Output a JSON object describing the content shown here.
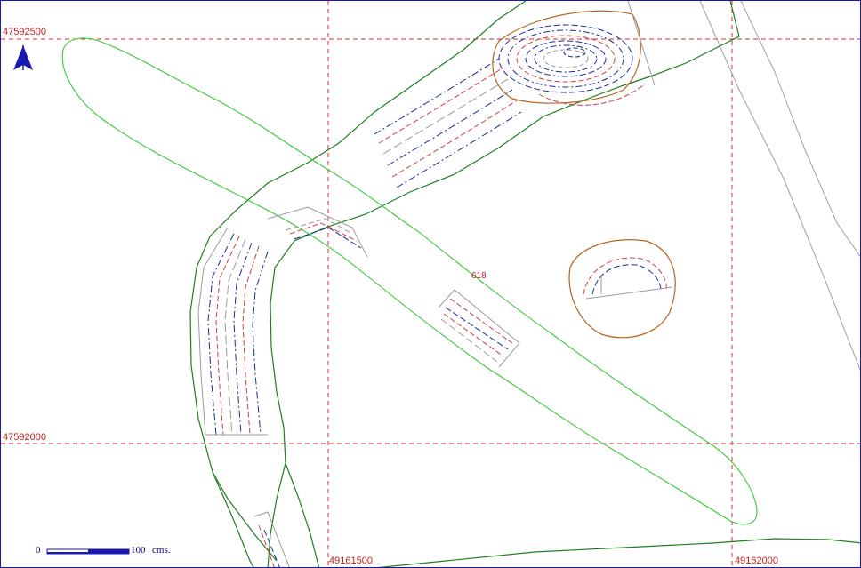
{
  "map": {
    "grid": {
      "northing_top": "47592500",
      "northing_bottom": "47592000",
      "easting_left": "49161500",
      "easting_right": "49162000"
    },
    "feature_label": "618",
    "scale_bar": {
      "start": "0",
      "end": "100",
      "unit": "cms."
    },
    "colors": {
      "grid": "#d42a2a",
      "trench_outline": "#2bb02b",
      "excavation_outline": "#1f7f1f",
      "contour_blue": "#1a2a9a",
      "contour_red": "#d04040",
      "contour_grey": "#9a9a9a",
      "pit_outline": "#b86420",
      "north_arrow": "#1a1ab0"
    },
    "icons": [
      "north-arrow-icon",
      "scale-bar-icon"
    ]
  }
}
